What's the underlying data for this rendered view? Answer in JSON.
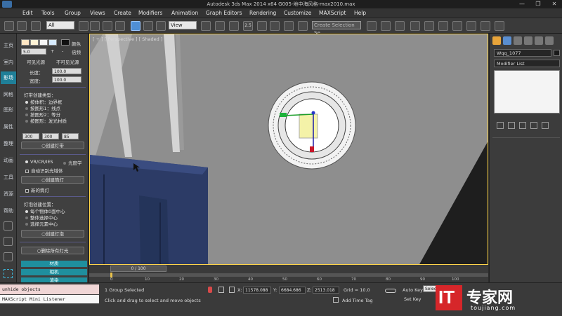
{
  "titlebar": {
    "title": "Autodesk 3ds Max  2014 x64      G005-地中海风格-max2010.max",
    "minimize": "—",
    "restore": "❐",
    "close": "✕"
  },
  "menu": [
    "Edit",
    "Tools",
    "Group",
    "Views",
    "Create",
    "Modifiers",
    "Animation",
    "Graph Editors",
    "Rendering",
    "Customize",
    "MAXScript",
    "Help"
  ],
  "toolbar": {
    "selection_filter": "All",
    "reference_coord": "View",
    "angle_snap": "2.5",
    "named_selection": "Create Selection Se"
  },
  "left_tabs": [
    "主页",
    "室内",
    "影场",
    "网格",
    "图形",
    "属性",
    "整理",
    "动画",
    "工具",
    "资源",
    "帮助"
  ],
  "left_tabs_active": 2,
  "left_panel": {
    "color_label": "颜色",
    "scale_value": "5.0",
    "plus": "+",
    "minus": "-",
    "multiplier": "倍频",
    "visible_btn": "可见光源",
    "invisible_btn": "不可见光源",
    "length_label": "长度：",
    "length_value": "100.0",
    "width_label": "宽度：",
    "width_value": "100.0",
    "strip_title": "灯带创建类型：",
    "strip_opts": [
      "按体积：边界框",
      "按图形1：线点",
      "按图形2：等分",
      "按图形：发光材质"
    ],
    "triple": [
      "300",
      "300",
      "85"
    ],
    "create_strip": "○创建灯带",
    "vray_ies": "VR/CR/IES",
    "photometric": "光度学",
    "auto_ies": "自动识别光域体",
    "create_spot": "○创建筒灯",
    "new_spot": "新的筒灯",
    "bulb_title": "灯泡创建位置：",
    "bulb_opts": [
      "每个物体0面中心",
      "整体选择中心",
      "选择元素中心"
    ],
    "create_bulb": "○创建灯泡",
    "delete_all": "○删除所有灯光",
    "bars": [
      "材质",
      "相机",
      "渲染"
    ]
  },
  "viewport": {
    "label": "[ + ] [ Perspective ] [ Shaded ]"
  },
  "right_panel": {
    "object_name": "Wqq_1077",
    "modifier_list": "Modifier List"
  },
  "timeline": {
    "slider": "0 / 100",
    "ticks": [
      "0",
      "10",
      "20",
      "30",
      "40",
      "50",
      "60",
      "70",
      "80",
      "90",
      "100"
    ]
  },
  "status": {
    "maxscript_line1": "unhide objects",
    "maxscript_line2": "MAXScript Mini Listener",
    "selected": "1 Group Selected",
    "prompt": "Click and drag to select and move objects",
    "x_label": "X:",
    "x_value": "11578.088",
    "y_label": "Y:",
    "y_value": "6684.686",
    "z_label": "Z:",
    "z_value": "2513.018",
    "grid": "Grid = 10.0",
    "add_time_tag": "Add Time Tag",
    "auto_key": "Auto Key",
    "set_key": "Set Key",
    "key_mode": "Selec"
  },
  "watermark": {
    "logo": "IT",
    "brand": "专家网",
    "url": "toujiang.com"
  },
  "colors": {
    "viewport_gray": "#8e8e8e",
    "active_tab": "#1f7f98",
    "selection_yellow": "#ffd54a",
    "sofa_blue": "#2c3b66",
    "watermark_red": "#d6262a"
  }
}
